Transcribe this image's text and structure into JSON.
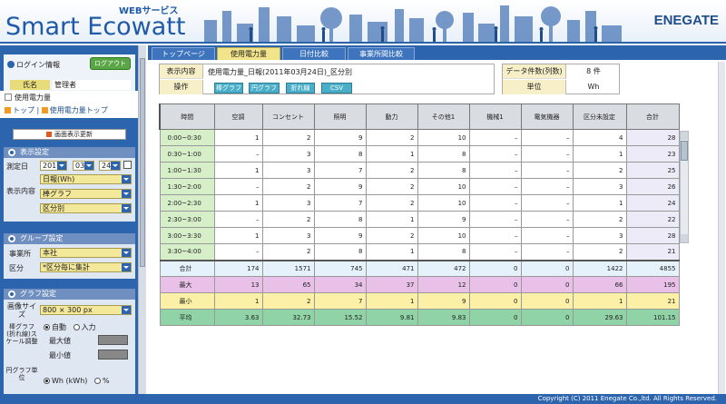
{
  "header": {
    "web_service": "WEBサービス",
    "title": "Smart Ecowatt",
    "brand": "ENEGATE"
  },
  "sidebar": {
    "login_title": "ログイン情報",
    "logout_label": "ログアウト",
    "name_label": "氏名",
    "name_value": "管理者",
    "nav_title": "使用電力量",
    "breadcrumb": [
      "トップ",
      "使用電力量トップ"
    ],
    "breadcrumb_sep": "|",
    "refresh_label": "画面表示更新",
    "display_settings": {
      "title": "表示設定",
      "date_label": "測定日",
      "year": "2011",
      "month": "03",
      "day": "24",
      "content_label": "表示内容",
      "period": "日報(Wh)",
      "graph_type": "棒グラフ",
      "breakdown": "区分別"
    },
    "group_settings": {
      "title": "グループ設定",
      "site_label": "事業所",
      "site_value": "本社",
      "division_label": "区分",
      "division_value": "*区分毎に集計"
    },
    "graph_settings": {
      "title": "グラフ設定",
      "size_label": "画像サイズ",
      "size_value": "800 × 300 px",
      "scale_label": "棒グラフ(折れ線)スケール調整",
      "auto_label": "自動",
      "manual_label": "入力",
      "max_label": "最大値",
      "min_label": "最小値",
      "pie_unit_label": "円グラフ単位",
      "unit_wh": "Wh (kWh)",
      "unit_pct": "%"
    }
  },
  "tabs": [
    "トップページ",
    "使用電力量",
    "日付比較",
    "事業所間比較"
  ],
  "active_tab": 1,
  "info": {
    "content_label": "表示内容",
    "content_value": "使用電力量_日報(2011年03月24日)_区分別",
    "ops_label": "操作",
    "ops": [
      "棒グラフ",
      "円グラフ",
      "折れ線",
      "CSV"
    ],
    "count_label": "データ件数(列数)",
    "count_value": "8 件",
    "unit_label": "単位",
    "unit_value": "Wh"
  },
  "table": {
    "headers": [
      "時間",
      "空調",
      "コンセント",
      "照明",
      "動力",
      "その他1",
      "機械1",
      "電気機器",
      "区分未設定",
      "合計"
    ],
    "rows": [
      [
        "0:00~0:30",
        "1",
        "2",
        "9",
        "2",
        "10",
        "–",
        "–",
        "4",
        "28"
      ],
      [
        "0:30~1:00",
        "–",
        "3",
        "8",
        "1",
        "8",
        "–",
        "–",
        "1",
        "23"
      ],
      [
        "1:00~1:30",
        "1",
        "3",
        "7",
        "2",
        "8",
        "–",
        "–",
        "2",
        "25"
      ],
      [
        "1:30~2:00",
        "–",
        "2",
        "9",
        "2",
        "10",
        "–",
        "–",
        "3",
        "26"
      ],
      [
        "2:00~2:30",
        "1",
        "3",
        "7",
        "2",
        "10",
        "–",
        "–",
        "1",
        "24"
      ],
      [
        "2:30~3:00",
        "–",
        "2",
        "8",
        "1",
        "9",
        "–",
        "–",
        "2",
        "22"
      ],
      [
        "3:00~3:30",
        "1",
        "3",
        "9",
        "2",
        "10",
        "–",
        "–",
        "3",
        "28"
      ],
      [
        "3:30~4:00",
        "–",
        "2",
        "8",
        "1",
        "8",
        "–",
        "–",
        "2",
        "21"
      ]
    ],
    "stats": [
      {
        "label": "合計",
        "cls": "sum",
        "values": [
          "174",
          "1571",
          "745",
          "471",
          "472",
          "0",
          "0",
          "1422",
          "4855"
        ]
      },
      {
        "label": "最大",
        "cls": "max",
        "values": [
          "13",
          "65",
          "34",
          "37",
          "12",
          "0",
          "0",
          "66",
          "195"
        ]
      },
      {
        "label": "最小",
        "cls": "min",
        "values": [
          "1",
          "2",
          "7",
          "1",
          "9",
          "0",
          "0",
          "1",
          "21"
        ]
      },
      {
        "label": "平均",
        "cls": "avg",
        "values": [
          "3.63",
          "32.73",
          "15.52",
          "9.81",
          "9.83",
          "0",
          "0",
          "29.63",
          "101.15"
        ]
      }
    ]
  },
  "footer": {
    "copyright": "Copyright (C) 2011 Enegate Co.,ltd. All Rights Reserved."
  },
  "colors": {
    "brand_blue": "#2c64ae",
    "tab_active": "#f2e48a",
    "time_cell": "#d7efc9",
    "max_row": "#e8c0e8",
    "min_row": "#fbf0a6",
    "avg_row": "#8fd3a7"
  }
}
